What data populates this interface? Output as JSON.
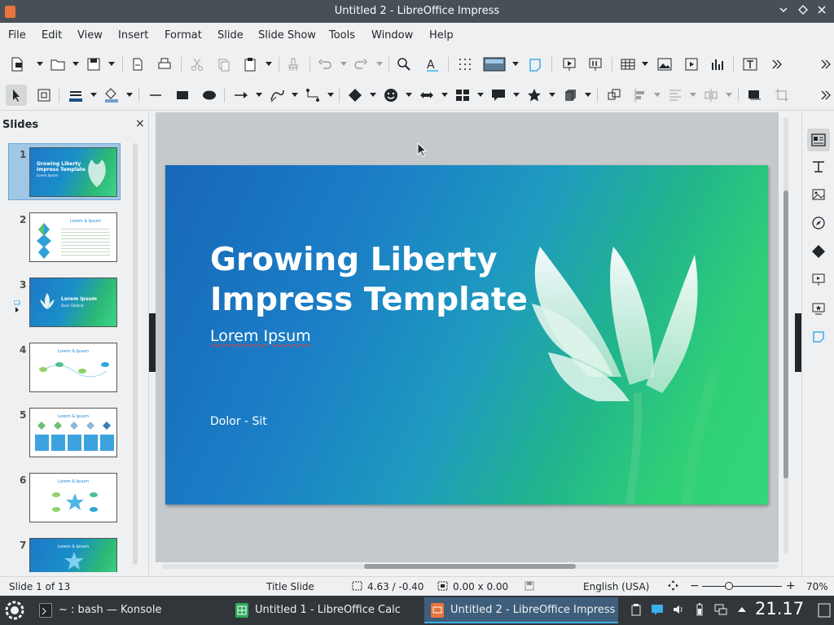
{
  "window": {
    "title": "Untitled 2 - LibreOffice Impress"
  },
  "menu": [
    "File",
    "Edit",
    "View",
    "Insert",
    "Format",
    "Slide",
    "Slide Show",
    "Tools",
    "Window",
    "Help"
  ],
  "slides_panel": {
    "header": "Slides",
    "thumbs": [
      {
        "num": "1",
        "title": "Growing Liberty Impress Template",
        "sub": "Lorem Ipsum",
        "style": "blue"
      },
      {
        "num": "2",
        "head": "Lorem & Ipsum",
        "style": "white"
      },
      {
        "num": "3",
        "title": "Lorem Ipsum",
        "sub": "Dolor Sitdoret",
        "style": "blue"
      },
      {
        "num": "4",
        "head": "Lorem & Ipsum",
        "style": "white"
      },
      {
        "num": "5",
        "head": "Lorem & Ipsum",
        "style": "white"
      },
      {
        "num": "6",
        "head": "Lorem & Ipsum",
        "style": "white"
      },
      {
        "num": "7",
        "head": "Lorem & Ipsum",
        "style": "blue"
      }
    ]
  },
  "slide": {
    "title_line1": "Growing Liberty",
    "title_line2": "Impress Template",
    "subtitle": "Lorem Ipsum",
    "footer": "Dolor - Sit"
  },
  "status": {
    "slide_pos": "Slide 1 of 13",
    "layout": "Title Slide",
    "position": "4.63 / -0.40",
    "size": "0.00 x 0.00",
    "language": "English (USA)",
    "zoom_minus": "−",
    "zoom_plus": "+",
    "zoom": "70%"
  },
  "taskbar": {
    "tasks": [
      {
        "label": "~ : bash — Konsole",
        "icon": "terminal-icon"
      },
      {
        "label": "Untitled 1 - LibreOffice Calc",
        "icon": "calc-icon"
      },
      {
        "label": "Untitled 2 - LibreOffice Impress",
        "icon": "impress-icon",
        "active": true
      }
    ],
    "clock": "21.17"
  }
}
